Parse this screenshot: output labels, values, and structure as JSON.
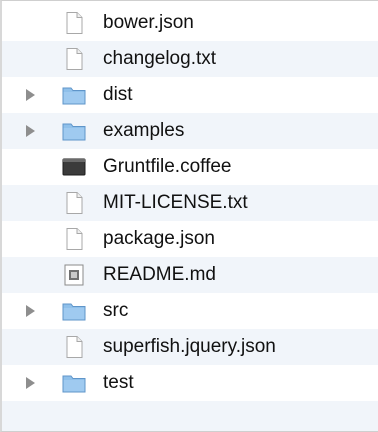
{
  "files": [
    {
      "name": "bower.json",
      "kind": "document-icon",
      "folder": false
    },
    {
      "name": "changelog.txt",
      "kind": "document-icon",
      "folder": false
    },
    {
      "name": "dist",
      "kind": "folder-icon",
      "folder": true
    },
    {
      "name": "examples",
      "kind": "folder-icon",
      "folder": true
    },
    {
      "name": "Gruntfile.coffee",
      "kind": "dark-file-icon",
      "folder": false
    },
    {
      "name": "MIT-LICENSE.txt",
      "kind": "document-icon",
      "folder": false
    },
    {
      "name": "package.json",
      "kind": "document-icon",
      "folder": false
    },
    {
      "name": "README.md",
      "kind": "markdown-file-icon",
      "folder": false
    },
    {
      "name": "src",
      "kind": "folder-icon",
      "folder": true
    },
    {
      "name": "superfish.jquery.json",
      "kind": "document-icon",
      "folder": false
    },
    {
      "name": "test",
      "kind": "folder-icon",
      "folder": true
    }
  ],
  "colors": {
    "row_stripe": "#f1f5fa",
    "folder_blue": "#7fb5e3",
    "disclosure_gray": "#8e8e8e"
  }
}
